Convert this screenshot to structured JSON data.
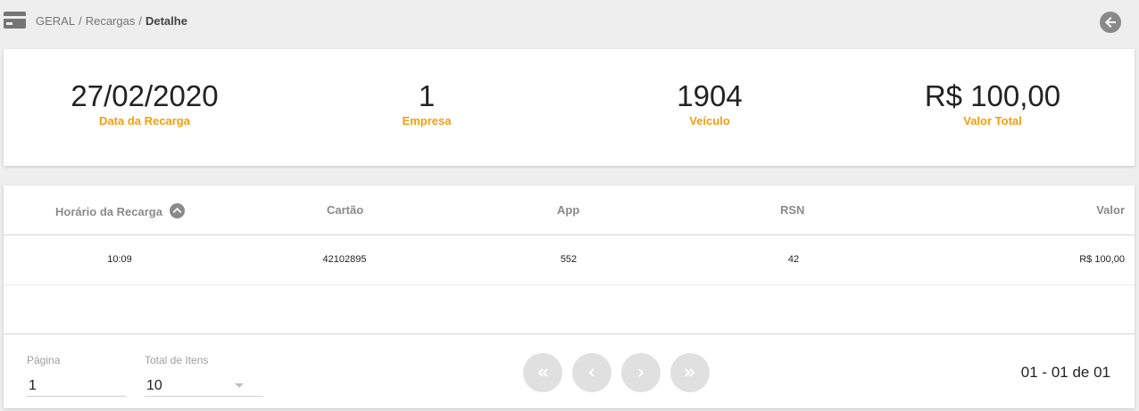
{
  "header": {
    "icon": "credit-card-icon",
    "breadcrumb": [
      "GERAL",
      "Recargas",
      "Detalhe"
    ],
    "separator": "/",
    "back_icon": "arrow-back-circle-icon"
  },
  "summary": {
    "date": {
      "value": "27/02/2020",
      "label": "Data da Recarga"
    },
    "empresa": {
      "value": "1",
      "label": "Empresa"
    },
    "veiculo": {
      "value": "1904",
      "label": "Veículo"
    },
    "valor": {
      "value": "R$ 100,00",
      "label": "Valor Total"
    },
    "label_color": "#f59e0b"
  },
  "table": {
    "columns": [
      "Horário da Recarga",
      "Cartão",
      "App",
      "RSN",
      "Valor"
    ],
    "sort_icon": "chevron-up-circle-icon",
    "rows": [
      {
        "horario": "10:09",
        "cartao": "42102895",
        "app": "552",
        "rsn": "42",
        "valor": "R$ 100,00"
      }
    ]
  },
  "pagination": {
    "page_label": "Página",
    "page_value": "1",
    "total_label": "Total de Itens",
    "total_value": "10",
    "buttons": [
      "first-page-icon",
      "prev-page-icon",
      "next-page-icon",
      "last-page-icon"
    ],
    "range_text": "01 - 01 de 01"
  }
}
